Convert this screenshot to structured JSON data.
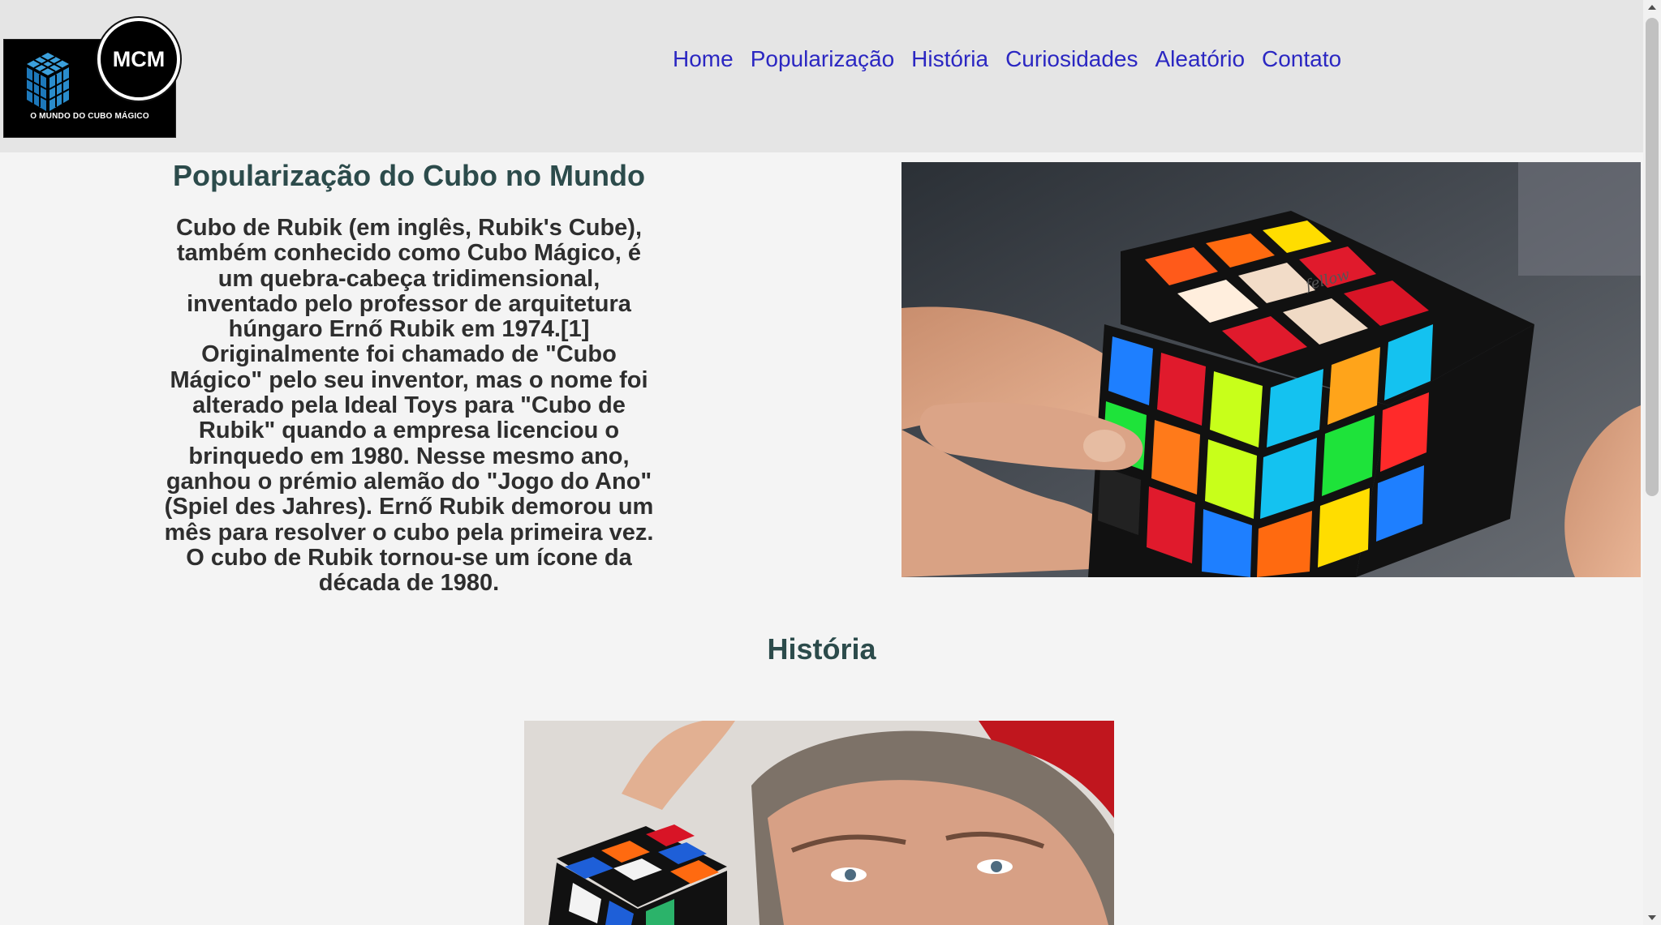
{
  "header": {
    "logo": {
      "badge_text": "MCM",
      "caption": "O MUNDO DO CUBO MÁGICO"
    },
    "nav": [
      {
        "label": "Home"
      },
      {
        "label": "Popularização"
      },
      {
        "label": "História"
      },
      {
        "label": "Curiosidades"
      },
      {
        "label": "Aleatório"
      },
      {
        "label": "Contato"
      }
    ]
  },
  "section_popularizacao": {
    "title": "Popularização do Cubo no Mundo",
    "text": "Cubo de Rubik (em inglês, Rubik's Cube), também conhecido como Cubo Mágico, é um quebra-cabeça tridimensional, inventado pelo professor de arquitetura húngaro Ernő Rubik em 1974.[1] Originalmente foi chamado de \"Cubo Mágico\" pelo seu inventor, mas o nome foi alterado pela Ideal Toys para \"Cubo de Rubik\" quando a empresa licenciou o brinquedo em 1980. Nesse mesmo ano, ganhou o prémio alemão do \"Jogo do Ano\" (Spiel des Jahres). Ernő Rubik demorou um mês para resolver o cubo pela primeira vez. O cubo de Rubik tornou-se um ícone da década de 1980.",
    "image_cube_text": "fellow"
  },
  "section_historia": {
    "title": "História"
  },
  "colors": {
    "header_bg": "#e5e5e5",
    "page_bg": "#f4f4f4",
    "link": "#2b27c2",
    "heading": "#2c4b4b",
    "body_text": "#2e2e2e"
  }
}
